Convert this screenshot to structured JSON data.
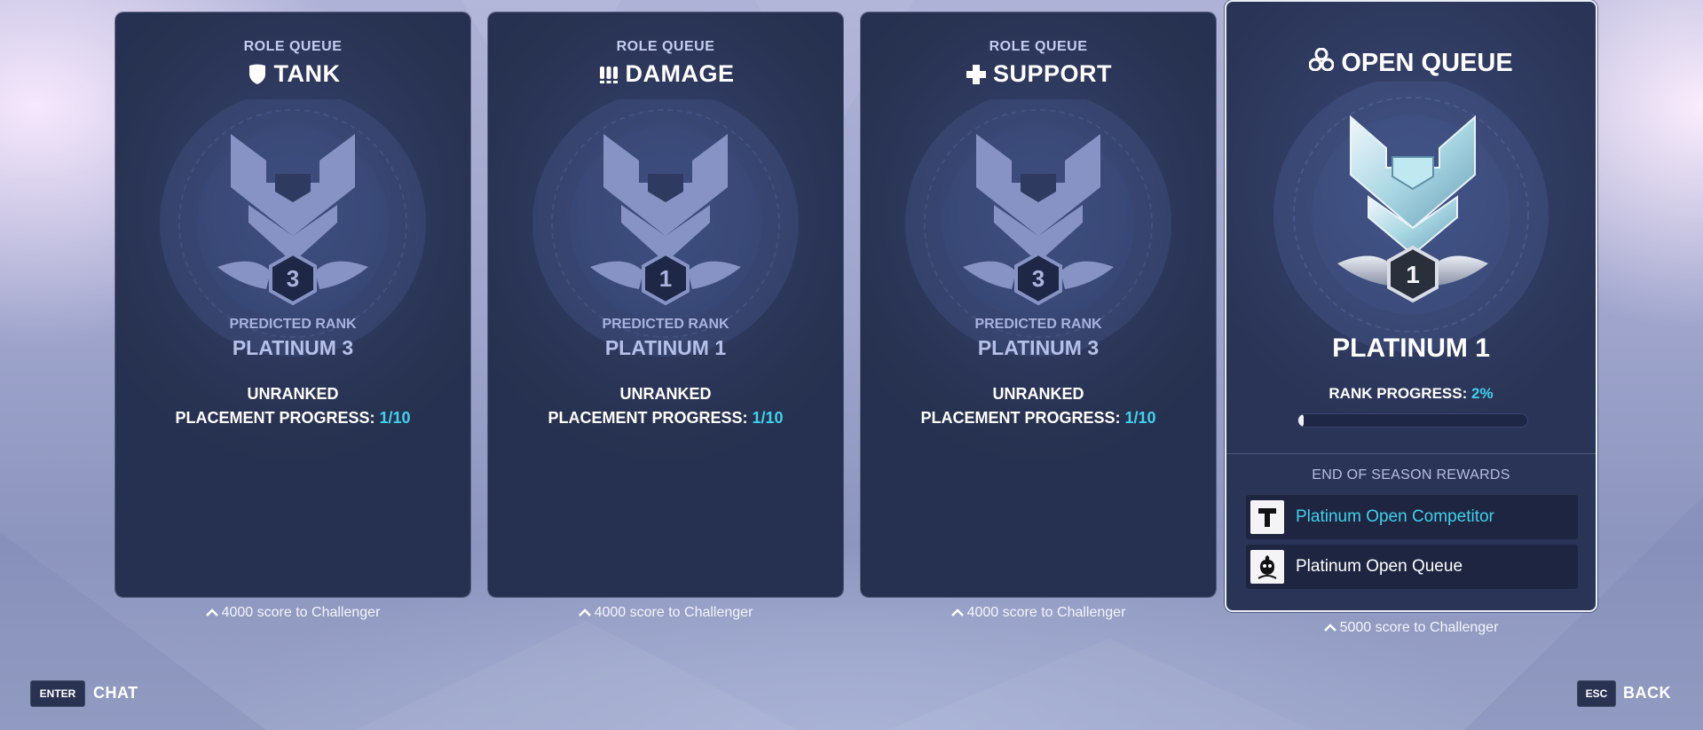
{
  "role_cards": [
    {
      "queue_label": "ROLE QUEUE",
      "role": "TANK",
      "icon": "shield-icon",
      "predicted_label": "PREDICTED RANK",
      "predicted_rank": "PLATINUM 3",
      "rank_division": "3",
      "status": "UNRANKED",
      "placement_label": "PLACEMENT PROGRESS:",
      "placement_value": "1/10",
      "score_text": "4000 score to Challenger"
    },
    {
      "queue_label": "ROLE QUEUE",
      "role": "DAMAGE",
      "icon": "bullets-icon",
      "predicted_label": "PREDICTED RANK",
      "predicted_rank": "PLATINUM 1",
      "rank_division": "1",
      "status": "UNRANKED",
      "placement_label": "PLACEMENT PROGRESS:",
      "placement_value": "1/10",
      "score_text": "4000 score to Challenger"
    },
    {
      "queue_label": "ROLE QUEUE",
      "role": "SUPPORT",
      "icon": "cross-icon",
      "predicted_label": "PREDICTED RANK",
      "predicted_rank": "PLATINUM 3",
      "rank_division": "3",
      "status": "UNRANKED",
      "placement_label": "PLACEMENT PROGRESS:",
      "placement_value": "1/10",
      "score_text": "4000 score to Challenger"
    }
  ],
  "open_queue": {
    "title": "OPEN QUEUE",
    "icon": "three-circles-icon",
    "rank": "PLATINUM 1",
    "rank_division": "1",
    "progress_label": "RANK PROGRESS:",
    "progress_value": "2%",
    "progress_fraction": 0.02,
    "rewards_label": "END OF SEASON REWARDS",
    "rewards": [
      {
        "text": "Platinum Open Competitor",
        "icon": "title-t-icon",
        "color": "#3fd2ea"
      },
      {
        "text": "Platinum Open Queue",
        "icon": "spray-icon",
        "color": "#ffffff"
      }
    ],
    "score_text": "5000 score to Challenger"
  },
  "footer": {
    "enter_key": "ENTER",
    "enter_label": "CHAT",
    "esc_key": "ESC",
    "esc_label": "BACK"
  },
  "colors": {
    "accent": "#3fd2ea",
    "card": "#283251"
  }
}
